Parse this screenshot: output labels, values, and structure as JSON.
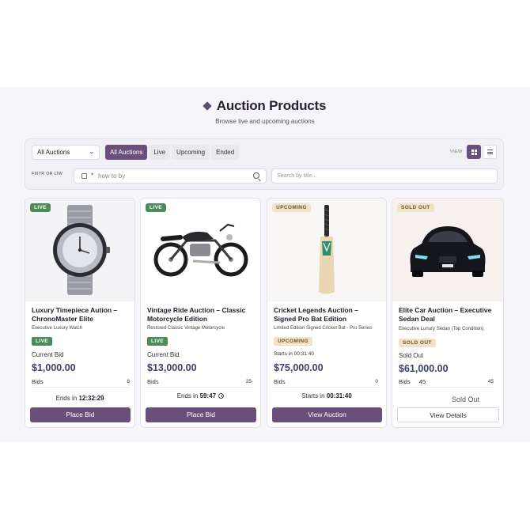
{
  "header": {
    "title": "Auction Products",
    "subtitle": "Browse live and upcoming auctions"
  },
  "toolbar": {
    "select_value": "All Auctions",
    "segments": [
      "All Auctions",
      "Live",
      "Upcoming",
      "Ended"
    ],
    "active_segment": "All Auctions",
    "view_label": "VIEW",
    "filter_label": "FIIITR OR LIW",
    "filter_placeholder": "how to by",
    "title_search_placeholder": "Search by title..."
  },
  "colors": {
    "accent": "#6a4f7b",
    "live": "#4f8a5a",
    "upcoming_bg": "#f0e3c8",
    "price": "#3b3f6b"
  },
  "cards": [
    {
      "image_icon": "watch-image",
      "badge": "LIVE",
      "title": "Luxury Timepiece Aution – ChronoMaster Elite",
      "subtitle": "Executive Luxury Watch",
      "status": "LIVE",
      "bid_label": "Current Bid",
      "price": "$1,000.00",
      "bids_label": "Bids",
      "bids_count": "8",
      "time_prefix": "Ends in",
      "time_value": "12:32:29",
      "button": "Place Bid"
    },
    {
      "image_icon": "motorcycle-image",
      "badge": "LIVE",
      "title": "Vintage Ride Auction – Classic Motorcycle Edition",
      "subtitle": "Restored Classic Vintage Motorcycle",
      "status": "LIVE",
      "bid_label": "Current Bid",
      "price": "$13,000.00",
      "bids_label": "Bids",
      "bids_count": "25",
      "time_prefix": "Ends in",
      "time_value": "59:47",
      "button": "Place Bid"
    },
    {
      "image_icon": "cricket-bat-image",
      "badge": "UPCOMING",
      "title": "Cricket Legends Auction – Signed Pro Bat Edition",
      "subtitle": "Limited Edition Signed Cricket Bat - Pro Series",
      "status": "UPCOMING",
      "bid_label": "Starts in 00:31:40",
      "price": "$75,000.00",
      "bids_label": "Bids",
      "bids_count": "0",
      "time_prefix": "Starts in",
      "time_value": "00:31:40",
      "button": "View Auction"
    },
    {
      "image_icon": "car-image",
      "badge": "SOLD OUT",
      "title": "Elite Car Auction – Executive Sedan Deal",
      "subtitle": "Executive Lunury Sedan (Top Condition)",
      "status": "SOLD OUT",
      "bid_label": "Sold Out",
      "price": "$61,000.00",
      "bids_label": "Bids",
      "bids_inline": "45",
      "bids_count": "45",
      "time_prefix": "Sold Out",
      "time_value": "",
      "button": "View Details"
    }
  ]
}
